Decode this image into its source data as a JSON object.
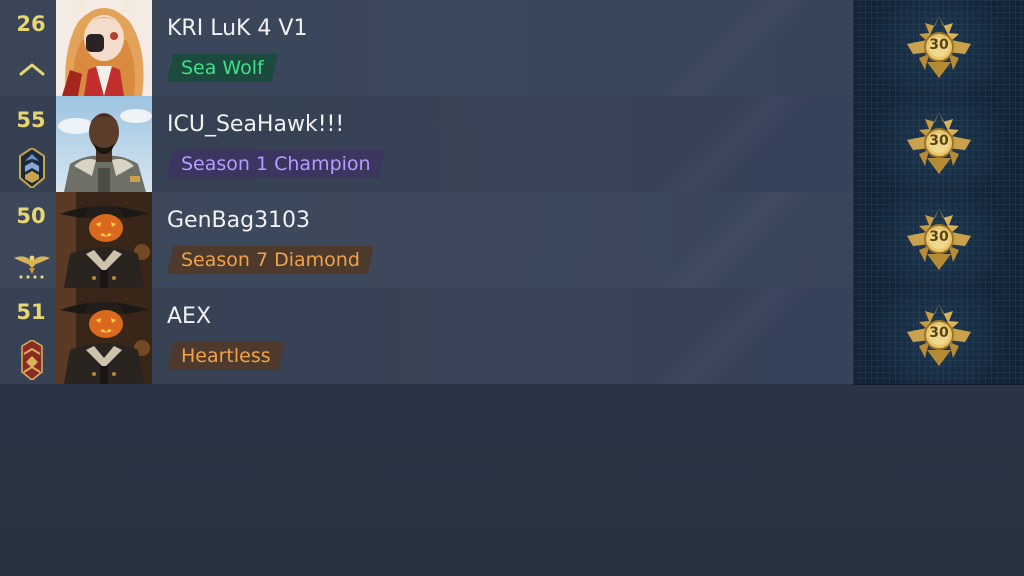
{
  "leaderboard": {
    "rows": [
      {
        "level": "26",
        "rank_icon": "chevron-up-icon",
        "avatar": "anime-girl-avatar",
        "name": "KRI LuK 4 V1",
        "title": "Sea Wolf",
        "title_color": "#3fe08a",
        "medal_label": "30"
      },
      {
        "level": "55",
        "rank_icon": "shield-rank-icon",
        "avatar": "officer-avatar",
        "name": "ICU_SeaHawk!!!",
        "title": "Season 1 Champion",
        "title_color": "#b59cff",
        "medal_label": "30"
      },
      {
        "level": "50",
        "rank_icon": "eagle-rank-icon",
        "avatar": "pumpkin-pirate-avatar",
        "name": "GenBag3103",
        "title": "Season 7 Diamond",
        "title_color": "#f0a24a",
        "medal_label": "30"
      },
      {
        "level": "51",
        "rank_icon": "chevron-badge-icon",
        "avatar": "pumpkin-pirate-avatar",
        "name": "AEX",
        "title": "Heartless",
        "title_color": "#f0a24a",
        "medal_label": "30"
      }
    ]
  }
}
